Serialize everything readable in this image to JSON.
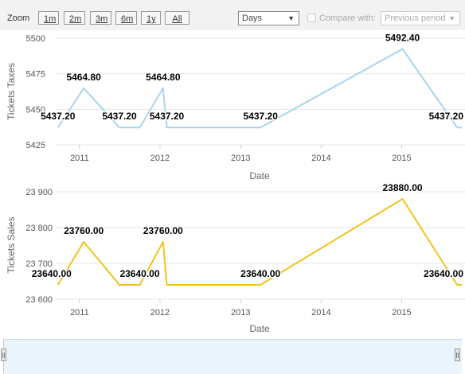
{
  "toolbar": {
    "zoom_label": "Zoom",
    "zoom_buttons": [
      "1m",
      "2m",
      "3m",
      "6m",
      "1y",
      "All"
    ],
    "interval_select": "Days",
    "compare_label": "Compare with:",
    "compare_select": "Previous period"
  },
  "colors": {
    "taxes": "#a8d4ee",
    "sales": "#f2c21a",
    "grid": "#e6e6e6"
  },
  "chart_data": [
    {
      "type": "line",
      "ylabel": "Tickets Taxes",
      "xlabel": "Date",
      "x_ticks": [
        "2011",
        "2012",
        "2013",
        "2014",
        "2015"
      ],
      "y_ticks": [
        "5425",
        "5450",
        "5475",
        "5500"
      ],
      "ylim": [
        5425,
        5500
      ],
      "xlim": [
        "2010-09-15",
        "2015-10-01"
      ],
      "grid": true,
      "series": [
        {
          "points": [
            {
              "x": "2010-09-25",
              "y": 5437.2,
              "label": "5437.20"
            },
            {
              "x": "2011-01-20",
              "y": 5464.8,
              "label": "5464.80"
            },
            {
              "x": "2011-07-01",
              "y": 5437.2,
              "label": "5437.20"
            },
            {
              "x": "2011-10-01",
              "y": 5437.2
            },
            {
              "x": "2012-01-15",
              "y": 5464.8,
              "label": "5464.80"
            },
            {
              "x": "2012-02-01",
              "y": 5437.2,
              "label": "5437.20"
            },
            {
              "x": "2013-04-01",
              "y": 5437.2,
              "label": "5437.20"
            },
            {
              "x": "2015-01-05",
              "y": 5492.4,
              "label": "5492.40"
            },
            {
              "x": "2015-09-10",
              "y": 5437.2,
              "label": "5437.20"
            },
            {
              "x": "2015-10-01",
              "y": 5437.2
            }
          ]
        }
      ]
    },
    {
      "type": "line",
      "ylabel": "Tickets Sales",
      "xlabel": "Date",
      "x_ticks": [
        "2011",
        "2012",
        "2013",
        "2014",
        "2015"
      ],
      "y_ticks": [
        "23 600",
        "23 700",
        "23 800",
        "23 900"
      ],
      "ylim": [
        23600,
        23900
      ],
      "xlim": [
        "2010-09-15",
        "2015-10-01"
      ],
      "grid": true,
      "series": [
        {
          "points": [
            {
              "x": "2010-09-25",
              "y": 23640.0,
              "label": "23640.00"
            },
            {
              "x": "2011-01-20",
              "y": 23760.0,
              "label": "23760.00"
            },
            {
              "x": "2011-07-01",
              "y": 23640.0
            },
            {
              "x": "2011-10-01",
              "y": 23640.0,
              "label": "23640.00"
            },
            {
              "x": "2012-01-15",
              "y": 23760.0,
              "label": "23760.00"
            },
            {
              "x": "2012-02-01",
              "y": 23640.0
            },
            {
              "x": "2013-04-01",
              "y": 23640.0,
              "label": "23640.00"
            },
            {
              "x": "2015-01-05",
              "y": 23880.0,
              "label": "23880.00"
            },
            {
              "x": "2015-09-10",
              "y": 23640.0,
              "label": "23640.00"
            },
            {
              "x": "2015-10-01",
              "y": 23640.0
            }
          ]
        }
      ]
    }
  ]
}
